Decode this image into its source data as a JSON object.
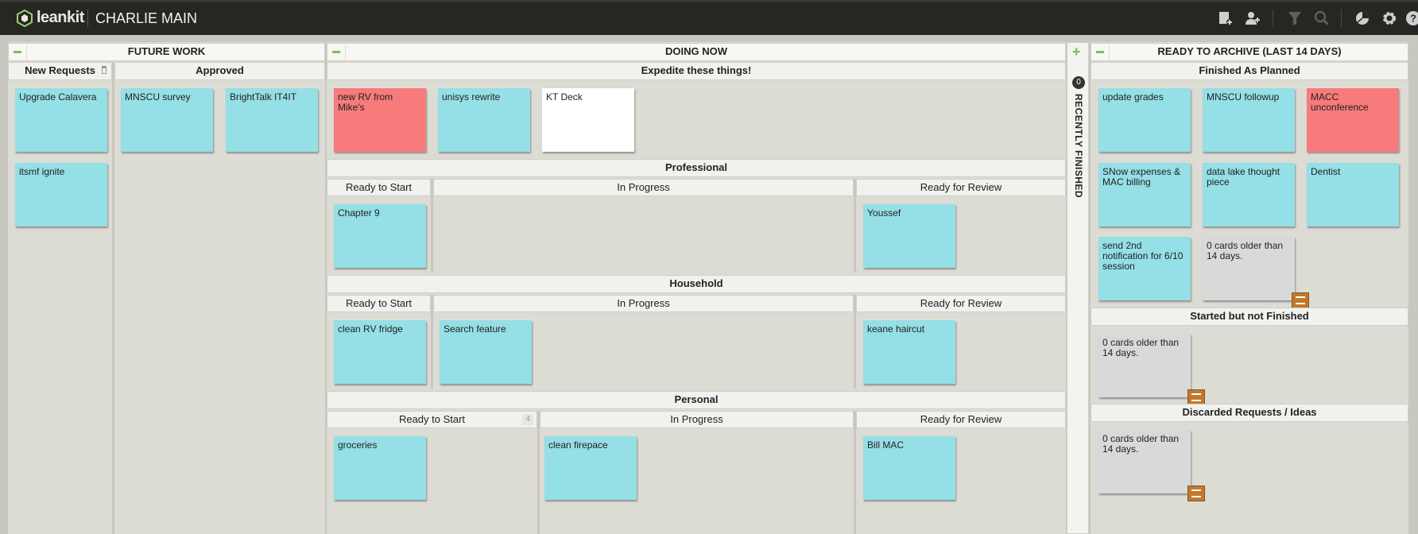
{
  "topbar": {
    "brand": "leankit",
    "board_name": "CHARLIE MAIN",
    "icons": [
      "add-card-icon",
      "add-user-icon",
      "filter-icon",
      "search-icon",
      "analytics-icon",
      "settings-icon",
      "help-icon"
    ]
  },
  "future_work": {
    "title": "FUTURE WORK",
    "new_requests": {
      "title": "New Requests",
      "cards": [
        "Upgrade Calavera",
        "itsmf ignite"
      ]
    },
    "approved": {
      "title": "Approved",
      "cards": [
        "MNSCU survey",
        "BrightTalk IT4IT"
      ]
    }
  },
  "doing_now": {
    "title": "DOING NOW",
    "expedite": {
      "title": "Expedite these things!",
      "cards": [
        "new RV from Mike's",
        "unisys rewrite",
        "KT Deck"
      ]
    },
    "professional": {
      "title": "Professional",
      "ready": "Ready to Start",
      "progress": "In Progress",
      "review": "Ready for Review",
      "ready_cards": [
        "Chapter 9"
      ],
      "review_cards": [
        "Youssef"
      ]
    },
    "household": {
      "title": "Household",
      "ready": "Ready to Start",
      "progress": "In Progress",
      "review": "Ready for Review",
      "ready_cards": [
        "clean RV fridge"
      ],
      "progress_cards": [
        "Search feature"
      ],
      "review_cards": [
        "keane haircut"
      ]
    },
    "personal": {
      "title": "Personal",
      "ready": "Ready to Start",
      "ready_count": "4",
      "progress": "In Progress",
      "review": "Ready for Review",
      "ready_cards": [
        "groceries"
      ],
      "progress_cards": [
        "clean firepace"
      ],
      "review_cards": [
        "Bill MAC"
      ]
    }
  },
  "recently_finished": {
    "count": "0",
    "label": "RECENTLY FINISHED"
  },
  "ready_to_archive": {
    "title": "READY TO ARCHIVE (LAST 14 DAYS)",
    "finished": {
      "title": "Finished As Planned",
      "cards": [
        "update grades",
        "MNSCU followup",
        "MACC unconference",
        "SNow expenses & MAC billing",
        "data lake thought piece",
        "Dentist",
        "send 2nd notification for 6/10 session"
      ],
      "older": "0 cards older than 14 days."
    },
    "started": {
      "title": "Started but not Finished",
      "older": "0 cards older than 14 days."
    },
    "discarded": {
      "title": "Discarded Requests / Ideas",
      "older": "0 cards older than 14 days."
    }
  },
  "colors": {
    "card_blue": "#95dfe6",
    "card_red": "#f77b7b",
    "card_white": "#ffffff",
    "accent_green": "#7cc04a",
    "topbar": "#262723"
  }
}
